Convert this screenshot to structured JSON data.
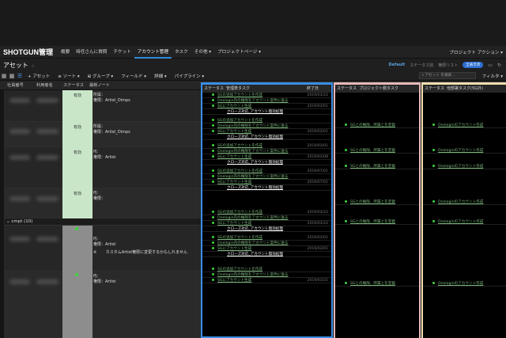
{
  "app": {
    "brand": "SHOTGUN管理"
  },
  "nav": {
    "items": [
      "概要",
      "時任さんに質問",
      "チケット",
      "アカウント管理",
      "タスク",
      "その他 ▾",
      "プロジェクトページ ▾"
    ],
    "right": "プロジェクト アクション ▾"
  },
  "page": {
    "title": "アセット",
    "title_icon": "☆"
  },
  "views": {
    "default": "Default",
    "status": "ステータス別",
    "perm": "権限リスト",
    "pill": "全表示済"
  },
  "toolbar": {
    "buttons": [
      "+ アセット",
      "≡ ソート ▾",
      "⊞ グループ ▾",
      "フィールド ▾",
      "詳細 ▾",
      "パイプライン ▾"
    ],
    "search_placeholder": "アセット を検索...",
    "filter": "フィルタ ▾"
  },
  "columns": [
    "社員番号",
    "利用者名",
    "ステータス",
    "最新ノート"
  ],
  "rows": [
    {
      "status": "有効",
      "note1": "所属：",
      "note2": "権限：Artist_Dimps"
    },
    {
      "status": "有効",
      "note1": "所属：",
      "note2": "権限：Artist_Dimps"
    },
    {
      "status": "有効",
      "note1": "PJ：",
      "note2": "権限：Artist"
    },
    {
      "status": "有効",
      "note1": "PJ：",
      "note2": "権限："
    }
  ],
  "group": {
    "label": "cmpt (10)"
  },
  "group_rows": [
    {
      "note1": "PJ：",
      "note2": "権限：Artist",
      "note3": "※ 　　カスタムArtist権限に変更するかもしれません"
    },
    {
      "note1": "PJ：",
      "note2": "権限：Artist"
    }
  ],
  "panel1": {
    "status_col": "ステータス",
    "header": "管理表タスク",
    "date_col": "終了日",
    "tasks": [
      {
        "text": "SGの追加アカウントを作成",
        "date": "2019/03/22",
        "kind": "g"
      },
      {
        "text": "Onelogin内の権限をアカウント案件に送る",
        "date": "",
        "kind": "g"
      },
      {
        "text": "SGにアカウント生成",
        "date": "2019/03/01",
        "kind": "g"
      },
      {
        "text": "クローズ対応_アカウント無効処理",
        "date": "",
        "kind": "w"
      },
      {
        "text": "SGの追加アカウントを作成",
        "date": "",
        "kind": "g"
      },
      {
        "text": "Onelogin内の権限をアカウント案件に送る",
        "date": "",
        "kind": "g"
      },
      {
        "text": "SGにアカウント生成",
        "date": "2019/03/01",
        "kind": "g"
      },
      {
        "text": "クローズ対応_アカウント無効処理",
        "date": "",
        "kind": "w"
      },
      {
        "text": "SGの追加アカウントを作成",
        "date": "2019/03/01",
        "kind": "g"
      },
      {
        "text": "Onelogin内の権限をアカウント案件に送る",
        "date": "",
        "kind": "g"
      },
      {
        "text": "SGにアカウント生成",
        "date": "2019/03/08",
        "kind": "g"
      },
      {
        "text": "クローズ対応_アカウント無効処理",
        "date": "",
        "kind": "w"
      },
      {
        "text": "SGの追加アカウントを作成",
        "date": "2019/07/01",
        "kind": "g"
      },
      {
        "text": "Onelogin内の権限をアカウント案件に送る",
        "date": "",
        "kind": "g"
      },
      {
        "text": "SGにアカウント生成",
        "date": "2019/07/01",
        "kind": "g"
      },
      {
        "text": "クローズ対応_アカウント無効処理",
        "date": "",
        "kind": "w"
      },
      {
        "text": "SGの追加アカウントを作成",
        "date": "2019/03/22",
        "kind": "g"
      },
      {
        "text": "Onelogin内の権限をアカウント案件に送る",
        "date": "",
        "kind": "g"
      },
      {
        "text": "SGにアカウント生成",
        "date": "2019/03/22",
        "kind": "g"
      },
      {
        "text": "クローズ対応_アカウント無効処理",
        "date": "",
        "kind": "w"
      },
      {
        "text": "SGの追加アカウントを作成",
        "date": "2019/03/01",
        "kind": "g"
      },
      {
        "text": "Onelogin内の権限をアカウント案件に送る",
        "date": "",
        "kind": "g"
      },
      {
        "text": "SGにアカウント生成",
        "date": "2019/03/01",
        "kind": "g"
      },
      {
        "text": "クローズ対応_アカウント無効処理",
        "date": "",
        "kind": "w"
      },
      {
        "text": "SGの追加アカウントを作成",
        "date": "",
        "kind": "g"
      },
      {
        "text": "Onelogin内の権限をアカウント案件に送る",
        "date": "",
        "kind": "g"
      },
      {
        "text": "SGにアカウント生成",
        "date": "2019/03/21",
        "kind": "g"
      }
    ]
  },
  "panel2": {
    "status_col": "ステータス",
    "header": "プロジェクト側タスク",
    "tasks": [
      "SGとの権限、所属とを定義",
      "SGとの権限、所属とを定義",
      "SGとの権限、所属とを定義",
      "SGとの権限、所属とを定義",
      "SGとの権限、所属とを定義",
      "SGとの権限、所属とを定義"
    ]
  },
  "panel3": {
    "status_col": "ステータス",
    "header": "他部署タスク(5G外)",
    "tasks": [
      "Oneloginのアカウント作成",
      "Oneloginのアカウント作成",
      "Oneloginのアカウント作成",
      "Oneloginのアカウント作成",
      "Oneloginのアカウント作成",
      "Oneloginのアカウント作成"
    ]
  },
  "colors": {
    "accent": "#2d8ad8",
    "panel1_border": "#3a8ee6",
    "panel2_border": "#e8b8b8",
    "panel3_border": "#f0e0b0",
    "status_active": "#c9e6c9",
    "dot": "#3bd43b"
  }
}
